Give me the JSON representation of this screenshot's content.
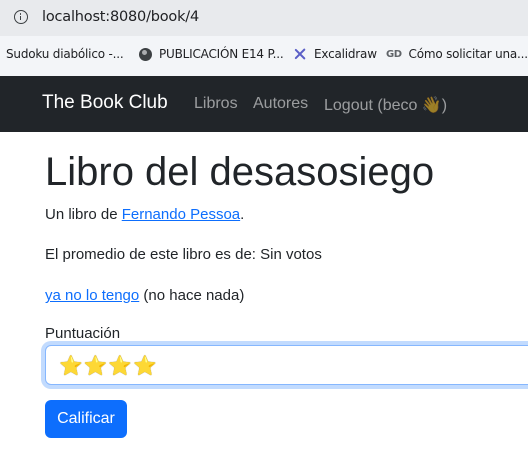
{
  "browser": {
    "url": "localhost:8080/book/4",
    "bookmarks": [
      {
        "label": "Sudoku diabólico -...",
        "icon": "none"
      },
      {
        "label": "PUBLICACIÓN E14 P...",
        "icon": "globe-icon"
      },
      {
        "label": "Excalidraw",
        "icon": "excalidraw-icon"
      },
      {
        "label": "Cómo solicitar una...",
        "icon": "gd-icon"
      }
    ]
  },
  "navbar": {
    "brand": "The Book Club",
    "links": [
      "Libros",
      "Autores",
      "Logout (beco 👋)"
    ]
  },
  "book": {
    "title": "Libro del desasosiego",
    "author_prefix": "Un libro de ",
    "author_name": "Fernando Pessoa",
    "author_suffix": ".",
    "average_text": "El promedio de este libro es de: Sin votos",
    "dont_have_link": "ya no lo tengo",
    "dont_have_note": " (no hace nada)"
  },
  "rating_form": {
    "label": "Puntuación",
    "selected": "⭐⭐⭐⭐",
    "submit_label": "Calificar"
  },
  "colors": {
    "navbar_bg": "#212529",
    "primary": "#0d6efd",
    "link": "#0d6efd"
  }
}
